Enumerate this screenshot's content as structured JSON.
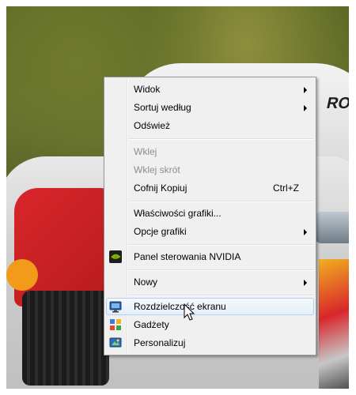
{
  "context_menu": {
    "items": [
      {
        "label": "Widok",
        "has_submenu": true
      },
      {
        "label": "Sortuj według",
        "has_submenu": true
      },
      {
        "label": "Odśwież"
      },
      {
        "label": "Wklej",
        "disabled": true
      },
      {
        "label": "Wklej skrót",
        "disabled": true
      },
      {
        "label": "Cofnij Kopiuj",
        "shortcut": "Ctrl+Z"
      },
      {
        "label": "Właściwości grafiki..."
      },
      {
        "label": "Opcje grafiki",
        "has_submenu": true
      },
      {
        "label": "Panel sterowania NVIDIA",
        "icon": "nvidia-icon"
      },
      {
        "label": "Nowy",
        "has_submenu": true
      },
      {
        "label": "Rozdzielczość ekranu",
        "icon": "display-icon",
        "highlighted": true
      },
      {
        "label": "Gadżety",
        "icon": "gadgets-icon"
      },
      {
        "label": "Personalizuj",
        "icon": "personalize-icon"
      }
    ]
  },
  "wallpaper": {
    "car_text": "RO"
  },
  "colors": {
    "menu_background": "#f0f0f0",
    "menu_border": "#979797",
    "highlight_border": "#aecff7",
    "disabled_text": "#8d8d8d"
  }
}
